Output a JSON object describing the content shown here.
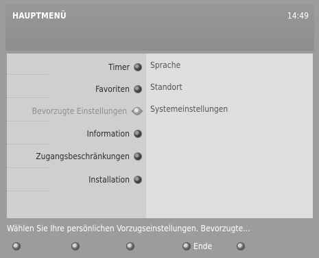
{
  "header": {
    "title": "HAUPTMENÜ",
    "time": "14:49"
  },
  "menu": {
    "items": [
      {
        "label": "Timer",
        "icon": "bullet-icon",
        "selected": false
      },
      {
        "label": "Favoriten",
        "icon": "bullet-icon",
        "selected": false
      },
      {
        "label": "Bevorzugte Einstellungen",
        "icon": "nav-cursor-icon",
        "selected": true
      },
      {
        "label": "Information",
        "icon": "bullet-icon",
        "selected": false
      },
      {
        "label": "Zugangsbeschränkungen",
        "icon": "bullet-icon",
        "selected": false
      },
      {
        "label": "Installation",
        "icon": "bullet-icon",
        "selected": false
      }
    ]
  },
  "submenu": {
    "items": [
      {
        "label": "Sprache"
      },
      {
        "label": "Standort"
      },
      {
        "label": "Systemeinstellungen"
      }
    ]
  },
  "status": {
    "text": "Wählen Sie Ihre persönlichen Vorzugseinstellungen. Bevorzugte..."
  },
  "footer": {
    "buttons": [
      {
        "label": "",
        "color": "red"
      },
      {
        "label": "",
        "color": "green"
      },
      {
        "label": "",
        "color": "yellow"
      },
      {
        "label": "Ende",
        "color": "blue"
      },
      {
        "label": "",
        "color": "white"
      }
    ]
  },
  "colors": {
    "background": "#9c9c9c",
    "menu_bg": "#cfcfcf",
    "submenu_bg": "#dedede",
    "text_light": "#ffffff"
  }
}
